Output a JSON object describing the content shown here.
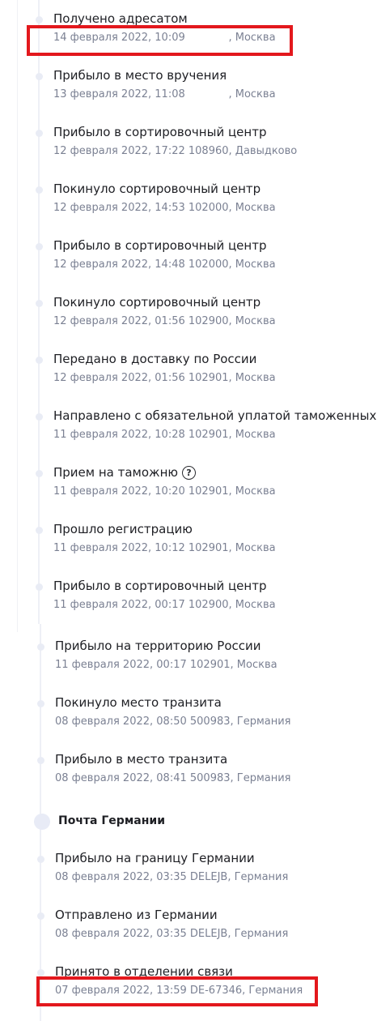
{
  "events": [
    {
      "status": "Получено адресатом",
      "date": "14 февраля 2022, 10:09",
      "place": "            , Москва"
    },
    {
      "status": "Прибыло в место вручения",
      "date": "13 февраля 2022, 11:08",
      "place": "            , Москва"
    },
    {
      "status": "Прибыло в сортировочный центр",
      "date": "12 февраля 2022, 17:22",
      "place": "108960, Давыдково"
    },
    {
      "status": "Покинуло сортировочный центр",
      "date": "12 февраля 2022, 14:53",
      "place": "102000, Москва"
    },
    {
      "status": "Прибыло в сортировочный центр",
      "date": "12 февраля 2022, 14:48",
      "place": "102000, Москва"
    },
    {
      "status": "Покинуло сортировочный центр",
      "date": "12 февраля 2022, 01:56",
      "place": "102900, Москва"
    },
    {
      "status": "Передано в доставку по России",
      "date": "12 февраля 2022, 01:56",
      "place": "102901, Москва"
    },
    {
      "status": "Направлено с обязательной уплатой таможенных п",
      "date": "11 февраля 2022, 10:28",
      "place": "102901, Москва"
    },
    {
      "status": "Прием на таможню",
      "date": "11 февраля 2022, 10:20",
      "place": "102901, Москва",
      "help": "?"
    },
    {
      "status": "Прошло регистрацию",
      "date": "11 февраля 2022, 10:12",
      "place": "102901, Москва"
    },
    {
      "status": "Прибыло в сортировочный центр",
      "date": "11 февраля 2022, 00:17",
      "place": "102900, Москва"
    },
    {
      "status": "Прибыло на территорию России",
      "date": "11 февраля 2022, 00:17",
      "place": "102901, Москва"
    },
    {
      "status": "Покинуло место транзита",
      "date": "08 февраля 2022, 08:50",
      "place": "500983, Германия"
    },
    {
      "status": "Прибыло в место транзита",
      "date": "08 февраля 2022, 08:41",
      "place": "500983, Германия"
    }
  ],
  "section": {
    "title": "Почта Германии"
  },
  "events_germany": [
    {
      "status": "Прибыло на границу Германии",
      "date": "08 февраля 2022, 03:35",
      "place": "DELEJB, Германия"
    },
    {
      "status": "Отправлено из Германии",
      "date": "08 февраля 2022, 03:35",
      "place": "DELEJB, Германия"
    },
    {
      "status": "Принято в отделении связи",
      "date": "07 февраля 2022, 13:59",
      "place": "DE-67346, Германия"
    }
  ],
  "colors": {
    "highlight": "#e3181d",
    "status_text": "#1e1f24",
    "meta_text": "#7b8193",
    "timeline_dot": "#e9ecf5"
  }
}
